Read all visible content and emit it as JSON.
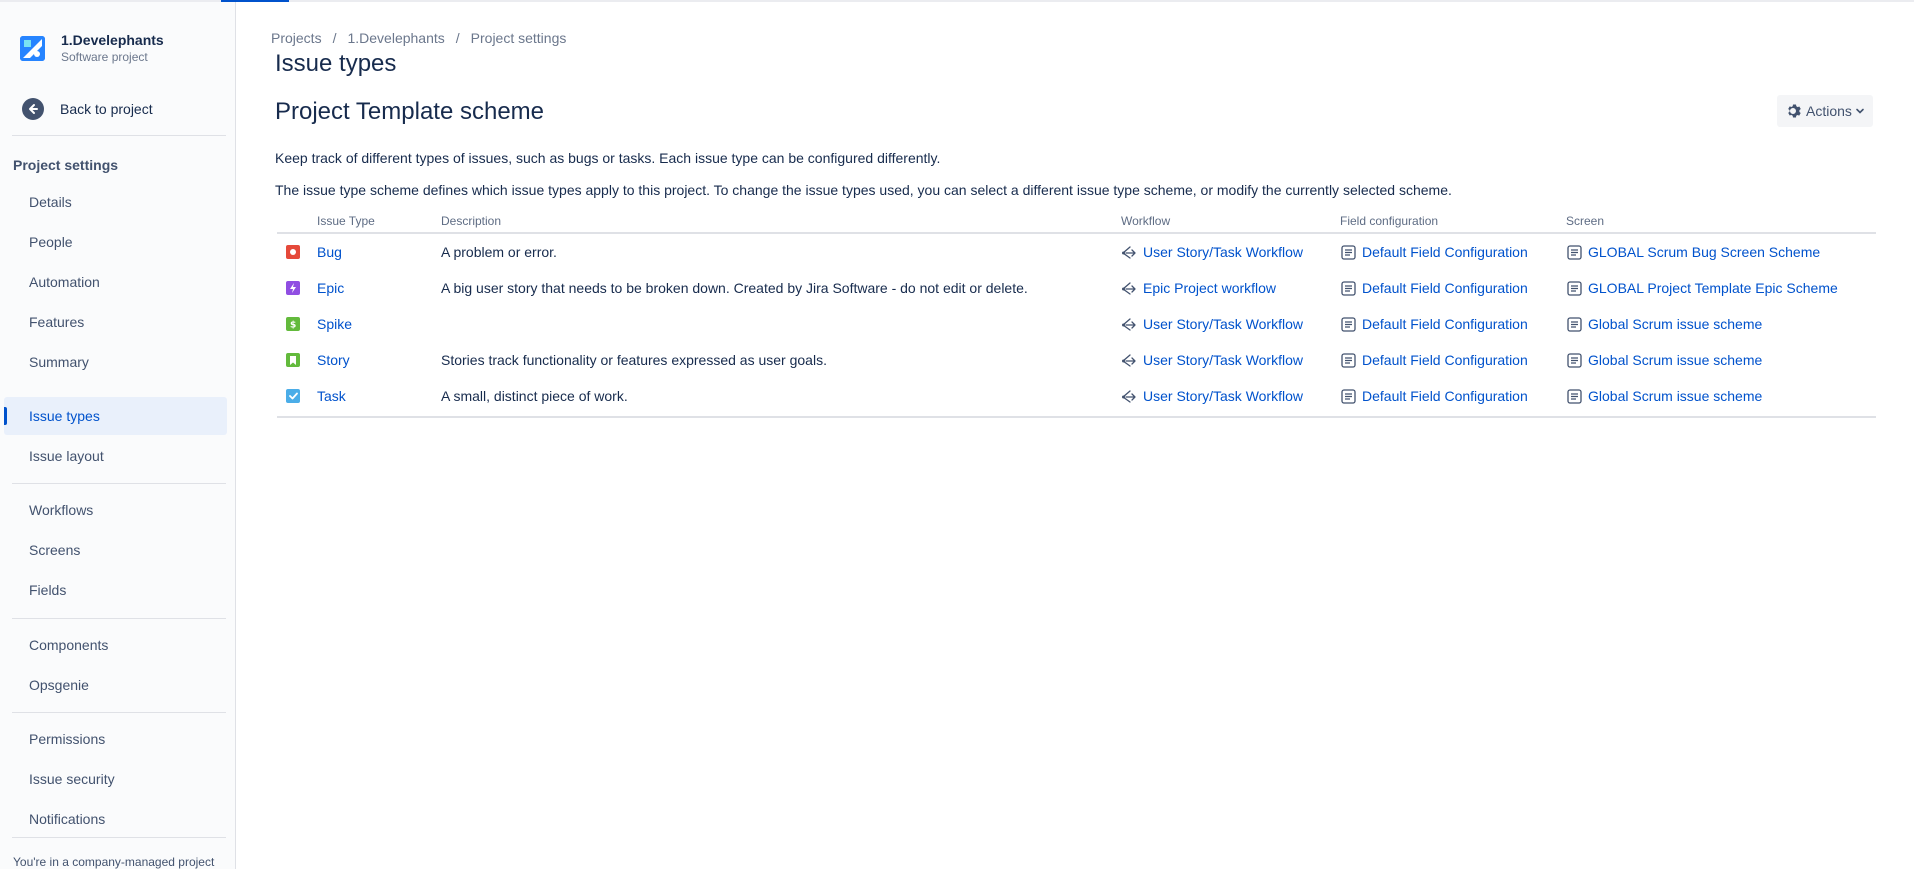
{
  "project": {
    "name": "1.Develephants",
    "type": "Software project"
  },
  "sidebar": {
    "back_label": "Back to project",
    "section_title": "Project settings",
    "group1": [
      "Details",
      "People",
      "Automation",
      "Features",
      "Summary"
    ],
    "group2": [
      "Issue types",
      "Issue layout"
    ],
    "group3": [
      "Workflows",
      "Screens",
      "Fields"
    ],
    "group4": [
      "Components",
      "Opsgenie"
    ],
    "group5": [
      "Permissions",
      "Issue security",
      "Notifications"
    ],
    "footer": "You're in a company-managed project",
    "active_item": "Issue types"
  },
  "breadcrumb": [
    "Projects",
    "1.Develephants",
    "Project settings"
  ],
  "page_title": "Issue types",
  "scheme_title": "Project Template scheme",
  "actions_label": "Actions",
  "description_1": "Keep track of different types of issues, such as bugs or tasks. Each issue type can be configured differently.",
  "description_2": "The issue type scheme defines which issue types apply to this project. To change the issue types used, you can select a different issue type scheme, or modify the currently selected scheme.",
  "table": {
    "headers": [
      "Issue Type",
      "Description",
      "Workflow",
      "Field configuration",
      "Screen"
    ],
    "rows": [
      {
        "type": "Bug",
        "icon": "bug-icon",
        "color": "#e5493a",
        "description": "A problem or error.",
        "workflow": "User Story/Task Workflow",
        "field_config": "Default Field Configuration",
        "screen": "GLOBAL Scrum Bug Screen Scheme"
      },
      {
        "type": "Epic",
        "icon": "epic-icon",
        "color": "#904ee2",
        "description": "A big user story that needs to be broken down. Created by Jira Software - do not edit or delete.",
        "workflow": "Epic Project workflow",
        "field_config": "Default Field Configuration",
        "screen": "GLOBAL Project Template Epic Scheme"
      },
      {
        "type": "Spike",
        "icon": "spike-icon",
        "color": "#63ba3c",
        "description": "",
        "workflow": "User Story/Task Workflow",
        "field_config": "Default Field Configuration",
        "screen": "Global Scrum issue scheme"
      },
      {
        "type": "Story",
        "icon": "story-icon",
        "color": "#63ba3c",
        "description": "Stories track functionality or features expressed as user goals.",
        "workflow": "User Story/Task Workflow",
        "field_config": "Default Field Configuration",
        "screen": "Global Scrum issue scheme"
      },
      {
        "type": "Task",
        "icon": "task-icon",
        "color": "#4bade8",
        "description": "A small, distinct piece of work.",
        "workflow": "User Story/Task Workflow",
        "field_config": "Default Field Configuration",
        "screen": "Global Scrum issue scheme"
      }
    ]
  },
  "colors": {
    "link": "#0052cc",
    "text": "#172b4d",
    "muted": "#6b778c",
    "active_bg": "#e9f0fb"
  }
}
